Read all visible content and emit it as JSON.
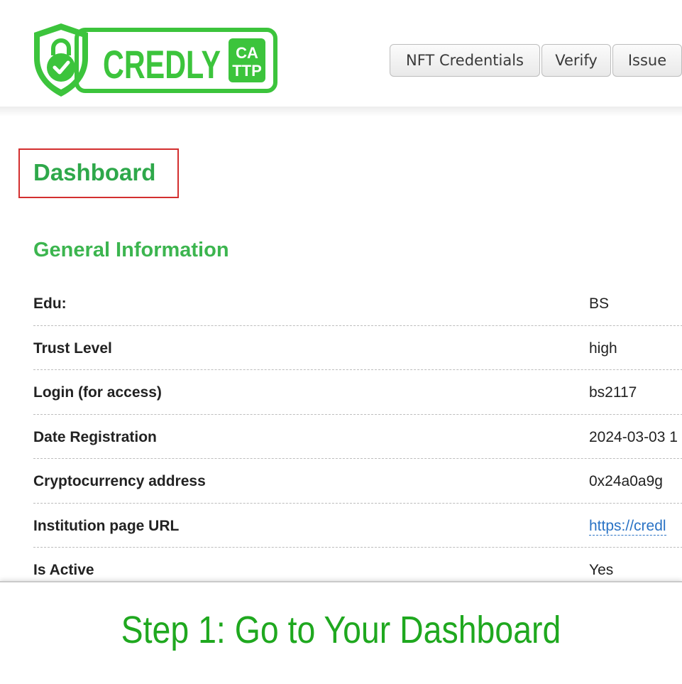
{
  "colors": {
    "brand_green": "#3cc43c",
    "title_green": "#2ea84a",
    "highlight_red": "#d32f2f",
    "link_blue": "#2a73c5",
    "caption_green": "#1fa81f"
  },
  "logo": {
    "icon": "shield-lock-check-icon",
    "wordmark": "CREDLY",
    "badge_line1": "CA",
    "badge_line2": "TTP"
  },
  "nav": {
    "items": [
      "NFT Credentials",
      "Verify",
      "Issue"
    ]
  },
  "page": {
    "title": "Dashboard",
    "section_title": "General Information"
  },
  "info_rows": [
    {
      "label": "Edu:",
      "value": "BS"
    },
    {
      "label": "Trust Level",
      "value": "high"
    },
    {
      "label": "Login (for access)",
      "value": "bs2117"
    },
    {
      "label": "Date Registration",
      "value": "2024-03-03 1"
    },
    {
      "label": "Cryptocurrency address",
      "value": "0x24a0a9g"
    },
    {
      "label": "Institution page URL",
      "value": "https://credl"
    },
    {
      "label": "Is Active",
      "value": "Yes"
    }
  ],
  "caption": "Step 1: Go to Your Dashboard"
}
